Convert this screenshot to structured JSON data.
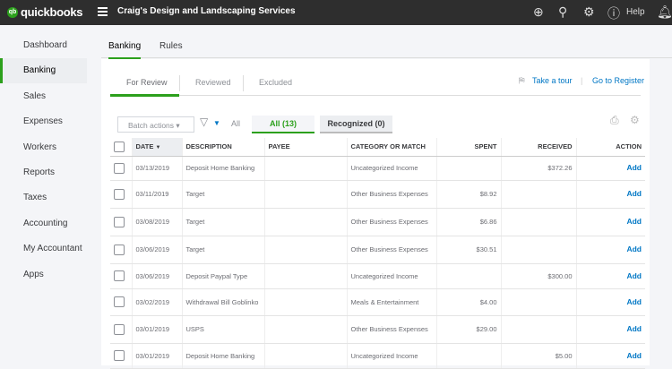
{
  "topbar": {
    "brand": "quickbooks",
    "company": "Craig's Design and Landscaping Services",
    "help": "Help"
  },
  "sidebar": {
    "items": [
      {
        "label": "Dashboard"
      },
      {
        "label": "Banking",
        "active": true
      },
      {
        "label": "Sales"
      },
      {
        "label": "Expenses"
      },
      {
        "label": "Workers"
      },
      {
        "label": "Reports"
      },
      {
        "label": "Taxes"
      },
      {
        "label": "Accounting"
      },
      {
        "label": "My Accountant"
      },
      {
        "label": "Apps"
      }
    ]
  },
  "tabs": [
    "Banking",
    "Rules"
  ],
  "subtabs": [
    "For Review",
    "Reviewed",
    "Excluded"
  ],
  "links": {
    "tour": "Take a tour",
    "register": "Go to Register"
  },
  "filters": {
    "batch": "Batch actions",
    "all_text": "All",
    "all_pill": "All (13)",
    "recognized": "Recognized (0)"
  },
  "colors": {
    "accent": "#2ca01c",
    "link": "#0077c5",
    "topbar": "#2e2e2e"
  },
  "table": {
    "headers": [
      "DATE",
      "DESCRIPTION",
      "PAYEE",
      "CATEGORY OR MATCH",
      "SPENT",
      "RECEIVED",
      "ACTION"
    ],
    "rows": [
      {
        "date": "03/13/2019",
        "desc": "Deposit Home Banking",
        "payee": "",
        "cat": "Uncategorized Income",
        "spent": "",
        "received": "$372.26",
        "action": "Add"
      },
      {
        "date": "03/11/2019",
        "desc": "Target",
        "payee": "",
        "cat": "Other Business Expenses",
        "spent": "$8.92",
        "received": "",
        "action": "Add"
      },
      {
        "date": "03/08/2019",
        "desc": "Target",
        "payee": "",
        "cat": "Other Business Expenses",
        "spent": "$6.86",
        "received": "",
        "action": "Add"
      },
      {
        "date": "03/06/2019",
        "desc": "Target",
        "payee": "",
        "cat": "Other Business Expenses",
        "spent": "$30.51",
        "received": "",
        "action": "Add"
      },
      {
        "date": "03/06/2019",
        "desc": "Deposit Paypal Type",
        "payee": "",
        "cat": "Uncategorized Income",
        "spent": "",
        "received": "$300.00",
        "action": "Add"
      },
      {
        "date": "03/02/2019",
        "desc": "Withdrawal Bill Goblinko",
        "payee": "",
        "cat": "Meals & Entertainment",
        "spent": "$4.00",
        "received": "",
        "action": "Add"
      },
      {
        "date": "03/01/2019",
        "desc": "USPS",
        "payee": "",
        "cat": "Other Business Expenses",
        "spent": "$29.00",
        "received": "",
        "action": "Add"
      },
      {
        "date": "03/01/2019",
        "desc": "Deposit Home Banking",
        "payee": "",
        "cat": "Uncategorized Income",
        "spent": "",
        "received": "$5.00",
        "action": "Add"
      }
    ]
  }
}
